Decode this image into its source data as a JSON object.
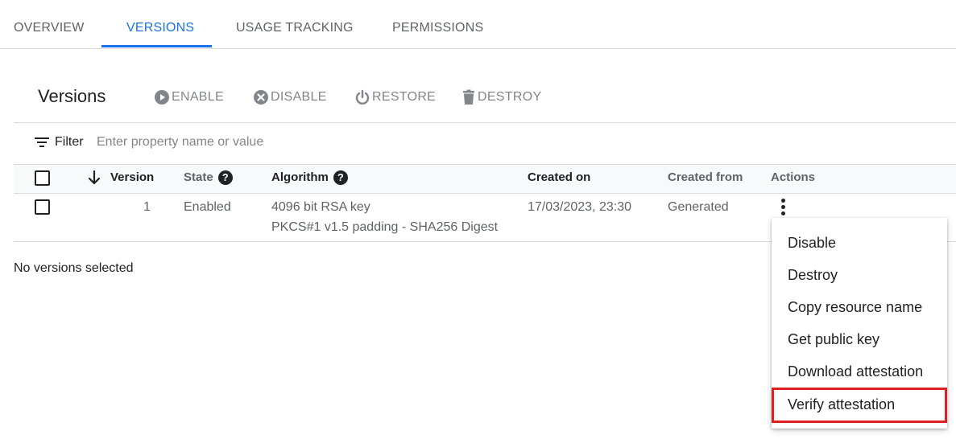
{
  "tabs": [
    {
      "label": "OVERVIEW",
      "active": false
    },
    {
      "label": "VERSIONS",
      "active": true
    },
    {
      "label": "USAGE TRACKING",
      "active": false
    },
    {
      "label": "PERMISSIONS",
      "active": false
    }
  ],
  "toolbar": {
    "title": "Versions",
    "buttons": [
      {
        "label": "ENABLE",
        "icon": "play-circle-icon"
      },
      {
        "label": "DISABLE",
        "icon": "cancel-circle-icon"
      },
      {
        "label": "RESTORE",
        "icon": "power-icon"
      },
      {
        "label": "DESTROY",
        "icon": "trash-icon"
      }
    ]
  },
  "filter": {
    "label": "Filter",
    "placeholder": "Enter property name or value",
    "icon": "filter-icon"
  },
  "table": {
    "columns": [
      "Version",
      "State",
      "Algorithm",
      "Created on",
      "Created from",
      "Actions"
    ],
    "sort_icon": "arrow-down-icon",
    "rows": [
      {
        "version": "1",
        "state": "Enabled",
        "algorithm_line1": "4096 bit RSA key",
        "algorithm_line2": "PKCS#1 v1.5 padding - SHA256 Digest",
        "created_on": "17/03/2023, 23:30",
        "created_from": "Generated"
      }
    ]
  },
  "status_text": "No versions selected",
  "actions_menu": {
    "items": [
      {
        "label": "Disable"
      },
      {
        "label": "Destroy"
      },
      {
        "label": "Copy resource name"
      },
      {
        "label": "Get public key"
      },
      {
        "label": "Download attestation"
      },
      {
        "label": "Verify attestation",
        "highlighted": true
      }
    ]
  },
  "colors": {
    "accent": "#1a73e8",
    "highlight_border": "#e02020",
    "disabled_text": "#80868b"
  }
}
